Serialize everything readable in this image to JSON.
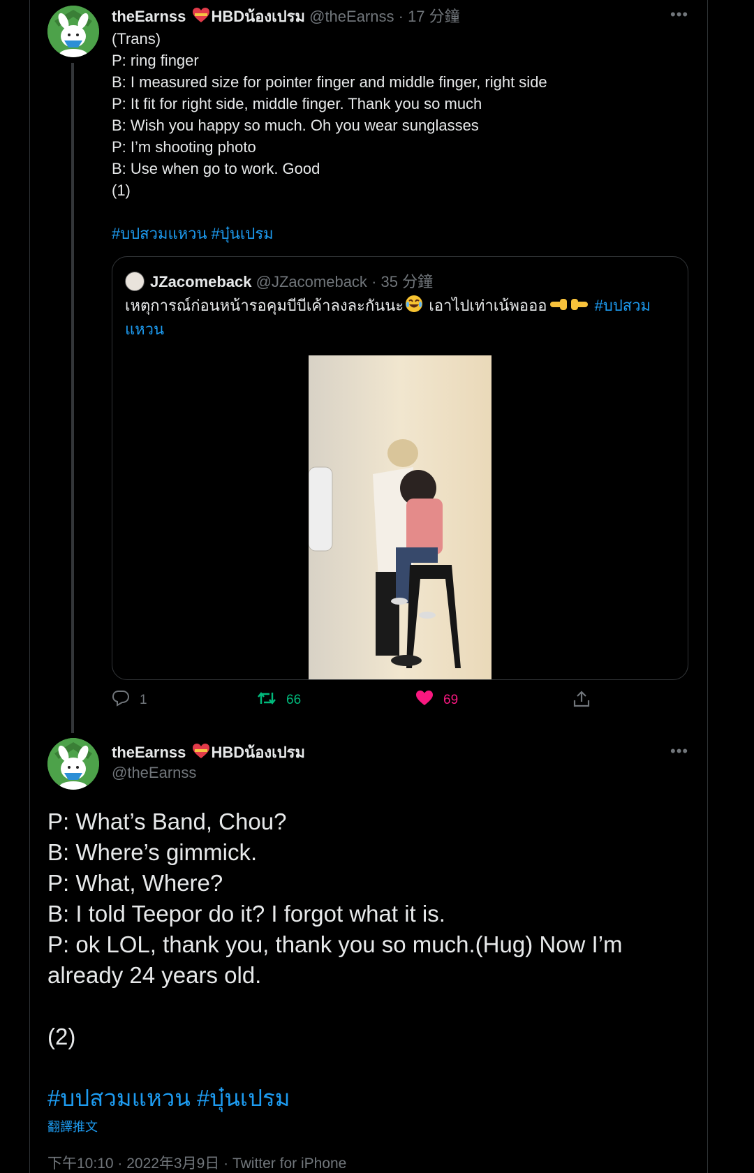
{
  "tweet1": {
    "display_name": "theEarnss",
    "name_suffix": "HBDน้องเปรม",
    "handle": "@theEarnss",
    "time": "· 17 分鐘",
    "lines": [
      "(Trans)",
      "P: ring finger",
      "B: I measured size for pointer finger and middle finger, right side",
      "P: It fit for right side, middle finger. Thank you so much",
      "B: Wish you happy so much. Oh you wear sunglasses",
      "P: I’m shooting photo",
      "B: Use when go to work. Good",
      "(1)"
    ],
    "hashtags": "#บปสวมแหวน #บุ๋นเปรม",
    "quote": {
      "display_name": "JZacomeback",
      "handle": "@JZacomeback",
      "time": "· 35 分鐘",
      "text_before_emoji": "เหตุการณ์ก่อนหน้ารอคุมบีบีเค้าลงละกันนะ",
      "text_after_emoji": " เอาไปเท่าเน้พอออ",
      "text_end": " #บปสวมแหวน"
    },
    "actions": {
      "replies": "1",
      "retweets": "66",
      "likes": "69"
    }
  },
  "tweet2": {
    "display_name": "theEarnss",
    "name_suffix": "HBDน้องเปรม",
    "handle": "@theEarnss",
    "lines": [
      "P: What’s Band, Chou?",
      "B: Where’s gimmick.",
      "P: What, Where?",
      "B: I told Teepor do it? I forgot what it is.",
      "P: ok LOL, thank you, thank you so much.(Hug) Now I’m already 24 years old.",
      "",
      "(2)"
    ],
    "hashtags": "#บปสวมแหวน #บุ๋นเปรม",
    "translate": "翻譯推文",
    "meta": "下午10:10 · 2022年3月9日 · Twitter for iPhone"
  },
  "colors": {
    "background": "#000000",
    "text": "#e7e9ea",
    "muted": "#71767b",
    "link": "#1d9bf0",
    "retweet": "#00ba7c",
    "like": "#f91880",
    "border": "#2f3336"
  },
  "icons": [
    "more-icon",
    "reply-icon",
    "retweet-icon",
    "heart-icon",
    "share-icon",
    "heart-gift-emoji",
    "laughing-emoji",
    "pointing-hands-emoji"
  ]
}
